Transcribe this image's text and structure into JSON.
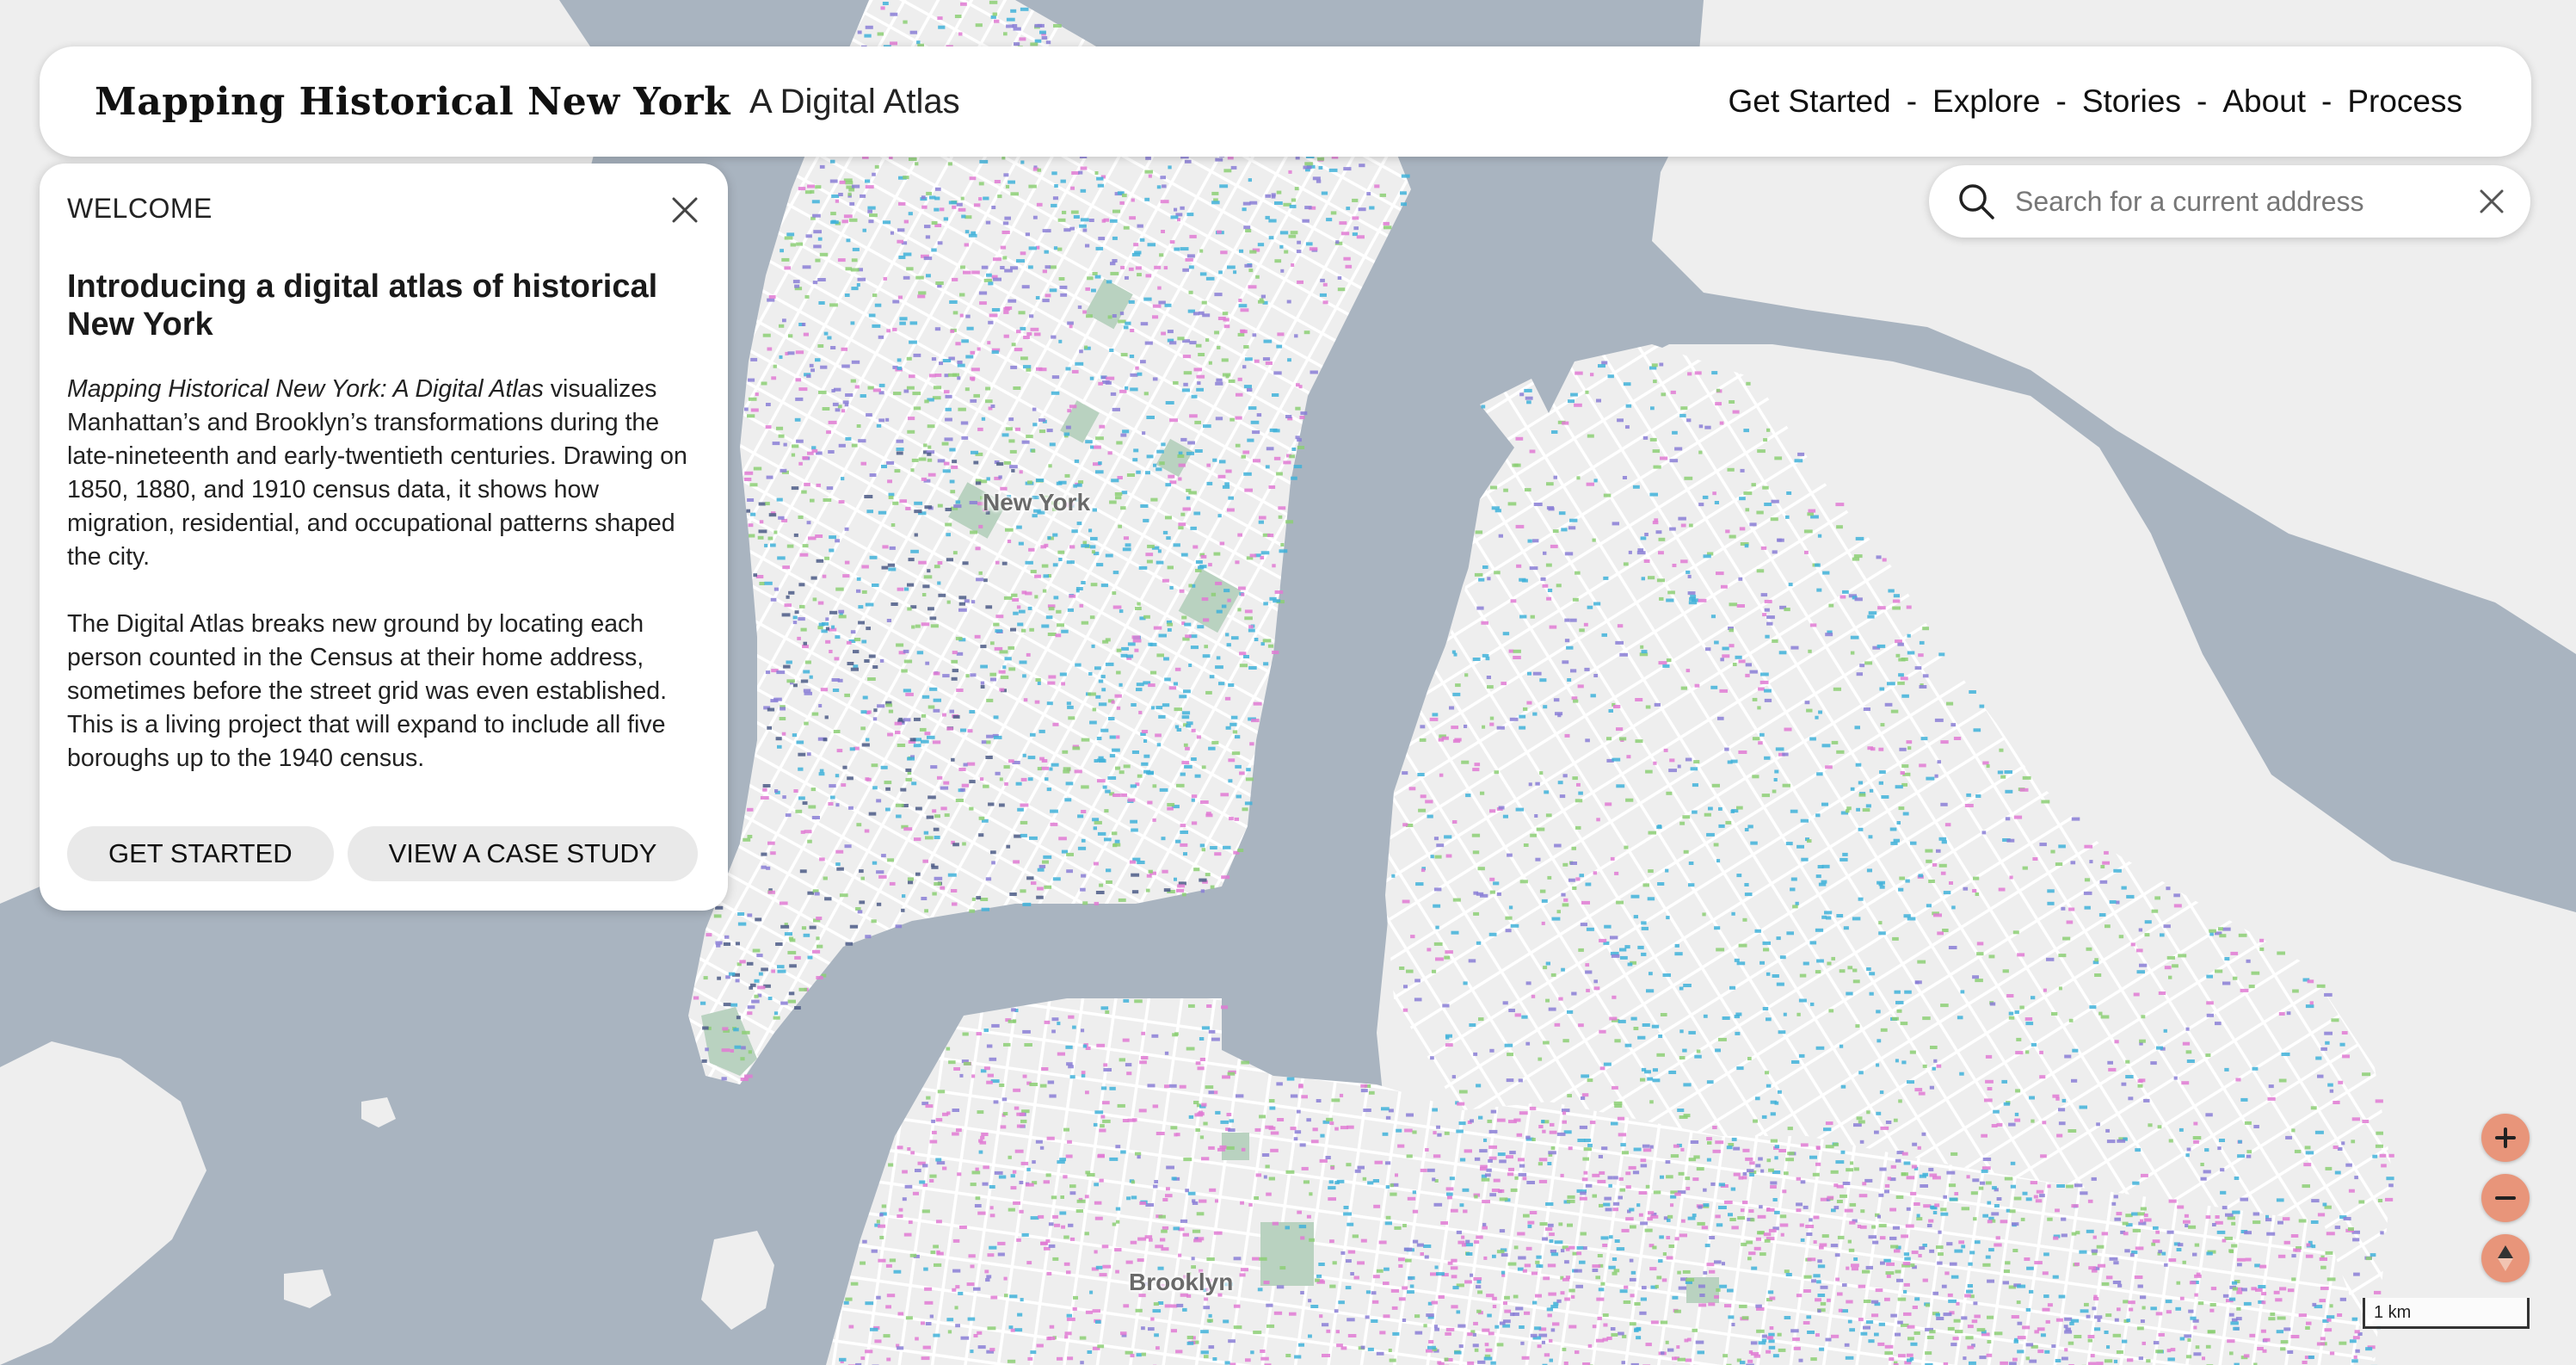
{
  "header": {
    "title": "Mapping Historical New York",
    "subtitle": "A Digital Atlas",
    "nav": [
      {
        "label": "Get Started"
      },
      {
        "label": "Explore"
      },
      {
        "label": "Stories"
      },
      {
        "label": "About"
      },
      {
        "label": "Process"
      }
    ],
    "separator": "-"
  },
  "search": {
    "placeholder": "Search for a current address",
    "value": ""
  },
  "welcome": {
    "kicker": "WELCOME",
    "title": "Introducing a digital atlas of historical New York",
    "intro_italic": "Mapping Historical New York: A Digital Atlas",
    "intro_rest": " visualizes Manhattan’s and Brooklyn’s transformations during the late-nineteenth and early-twentieth centuries. Drawing on 1850, 1880, and 1910 census data, it shows how migration, residential, and occupational patterns shaped the city.",
    "paragraph2": "The Digital Atlas breaks new ground by locating each person counted in the Census at their home address, sometimes before the street grid was even established. This is a living project that will expand to include all five boroughs up to the 1940 census.",
    "buttons": {
      "get_started": "GET STARTED",
      "case_study": "VIEW A CASE STUDY"
    }
  },
  "map": {
    "labels": {
      "new_york": "New York",
      "brooklyn": "Brooklyn"
    },
    "scale_label": "1 km",
    "colors": {
      "water": "#a9b4c0",
      "land": "#eeeeee",
      "streets": "#ffffff",
      "park": "#b9d2c0",
      "dot_blue": "#3fb1d9",
      "dot_pink": "#e07ad4",
      "dot_green": "#8ccf74",
      "dot_purple": "#8a7ed6",
      "dot_navy": "#4b5b86"
    }
  },
  "controls": {
    "zoom_in_icon": "plus-icon",
    "zoom_out_icon": "minus-icon",
    "compass_icon": "compass-icon",
    "accent": "#e8957a"
  }
}
